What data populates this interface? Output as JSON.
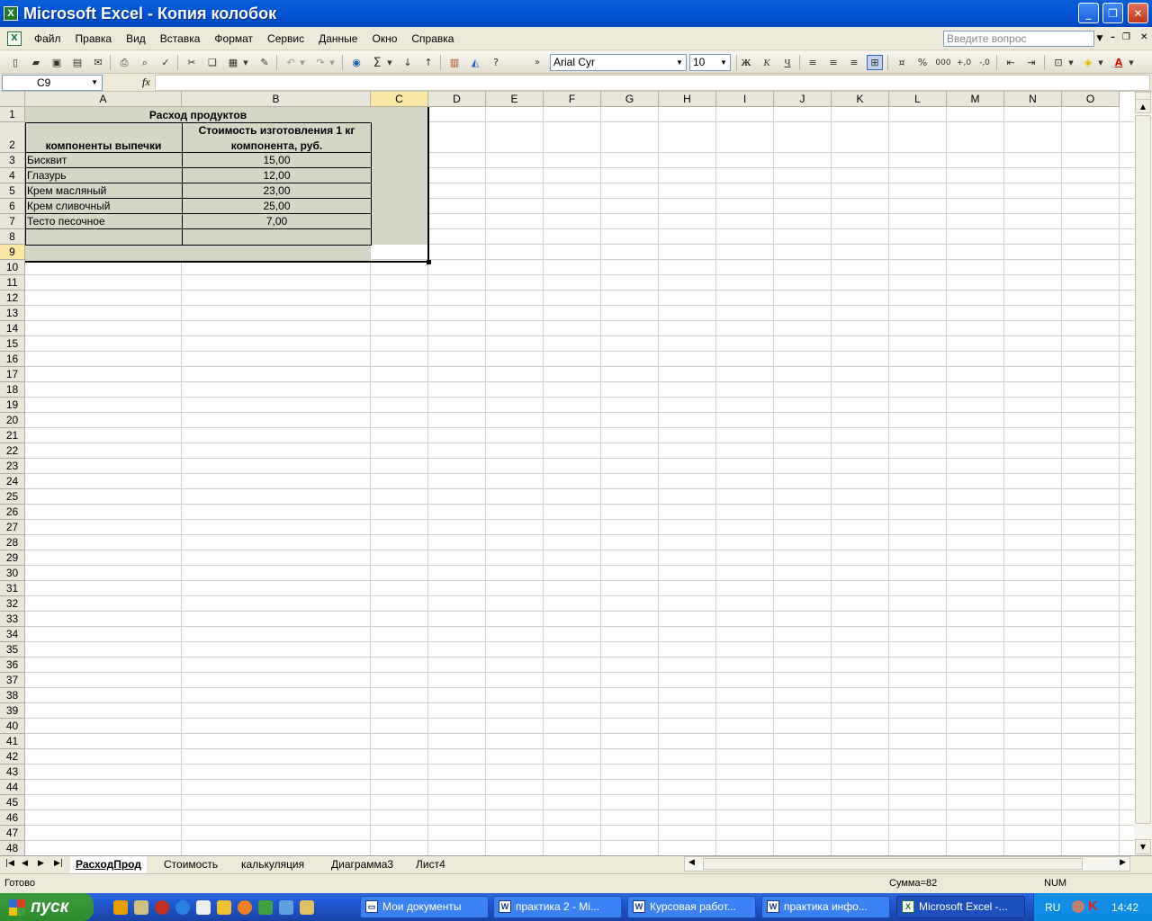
{
  "window": {
    "title": "Microsoft Excel - Копия колобок"
  },
  "menu": {
    "items": [
      "Файл",
      "Правка",
      "Вид",
      "Вставка",
      "Формат",
      "Сервис",
      "Данные",
      "Окно",
      "Справка"
    ],
    "ask_placeholder": "Введите вопрос"
  },
  "toolbar": {
    "font_name": "Arial Cyr",
    "font_size": "10",
    "bold": "Ж",
    "italic": "К",
    "underline": "Ч",
    "percent": "%",
    "thousands": "000",
    "sum": "Σ"
  },
  "formula": {
    "name_box": "C9",
    "fx": "fx",
    "content": ""
  },
  "columns": [
    "A",
    "B",
    "C",
    "D",
    "E",
    "F",
    "G",
    "H",
    "I",
    "J",
    "K",
    "L",
    "M",
    "N",
    "O"
  ],
  "rows_count": 48,
  "table": {
    "title": "Расход продуктов",
    "header_a": "компоненты выпечки",
    "header_b_line1": "Стоимость изготовления 1 кг",
    "header_b_line2": "компонента, руб.",
    "rows": [
      {
        "name": "Бисквит",
        "value": "15,00"
      },
      {
        "name": "Глазурь",
        "value": "12,00"
      },
      {
        "name": "Крем масляный",
        "value": "23,00"
      },
      {
        "name": "Крем сливочный",
        "value": "25,00"
      },
      {
        "name": "Тесто песочное",
        "value": "7,00"
      }
    ]
  },
  "sheets": [
    "РасходПрод",
    "Стоимость",
    "калькуляция",
    "Диаграмма3",
    "Лист4"
  ],
  "status": {
    "ready": "Готово",
    "sum": "Сумма=82",
    "num": "NUM"
  },
  "taskbar": {
    "start": "пуск",
    "tasks": [
      "Мои документы",
      "практика 2 - Mi...",
      "Курсовая работ...",
      "практика инфо...",
      "Microsoft Excel -..."
    ],
    "lang": "RU",
    "clock": "14:42"
  }
}
